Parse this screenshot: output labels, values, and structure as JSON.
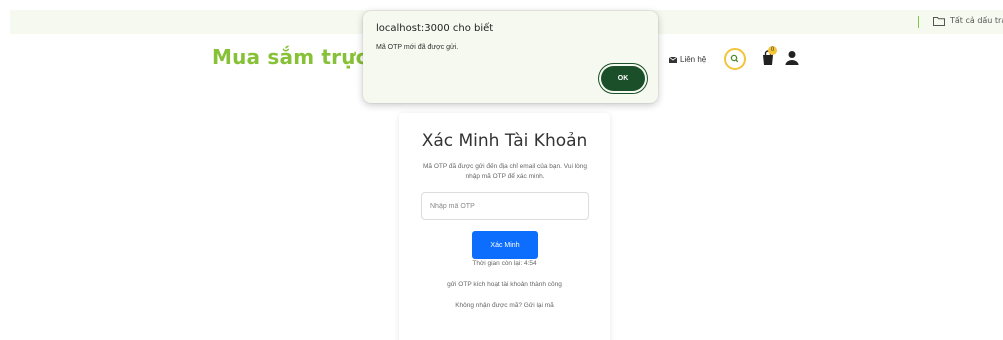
{
  "bookmarks": {
    "folder_label": "Tất cả dấu trang"
  },
  "header": {
    "brand": "Mua sắm trực t",
    "contact_label": "Liên hệ",
    "cart_count": "0"
  },
  "verify": {
    "title": "Xác Minh Tài Khoản",
    "description": "Mã OTP đã được gửi đến địa chỉ email của bạn. Vui lòng nhập mã OTP để xác minh.",
    "otp_placeholder": "Nhập mã OTP",
    "otp_value": "",
    "submit_label": "Xác Minh",
    "timer_text": "Thời gian còn lại: 4:54",
    "success_text": "gửi OTP kích hoạt tài khoản thành công",
    "resend_text": "Không nhận được mã? Gửi lại mã"
  },
  "dialog": {
    "origin": "localhost:3000 cho biết",
    "message": "Mã OTP mới đã được gửi.",
    "ok_label": "OK"
  },
  "colors": {
    "brand_green": "#86c137",
    "accent_yellow": "#f3c53a",
    "primary_blue": "#0d6efd",
    "ok_dark_green": "#1b4f2a",
    "dialog_bg": "#f6f9ef"
  },
  "icons": [
    "folder-icon",
    "mail-icon",
    "search-icon",
    "shopping-bag-icon",
    "user-icon"
  ]
}
